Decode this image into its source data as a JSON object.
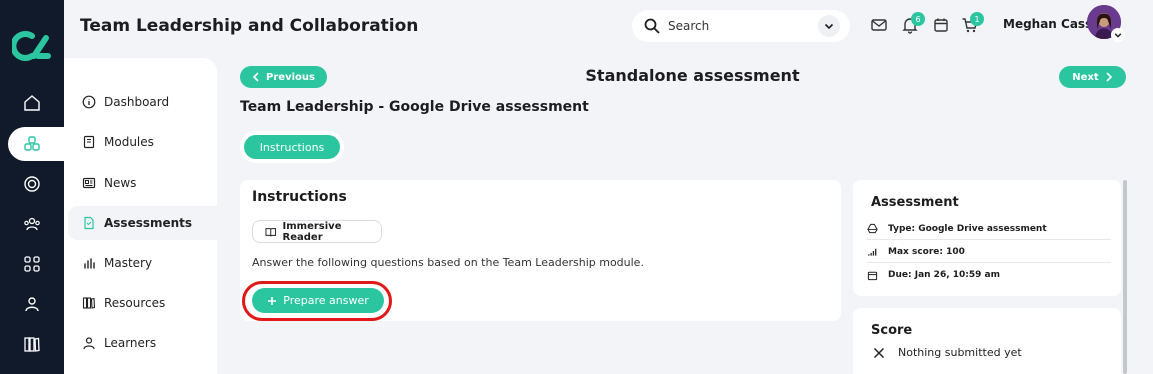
{
  "header": {
    "title": "Team Leadership and Collaboration",
    "search_placeholder": "Search",
    "notifications_count": "6",
    "cart_count": "1",
    "user_name": "Meghan Cass"
  },
  "sidebar": {
    "items": [
      {
        "label": "Dashboard",
        "icon": "info-circle-icon"
      },
      {
        "label": "Modules",
        "icon": "book-icon"
      },
      {
        "label": "News",
        "icon": "newspaper-icon"
      },
      {
        "label": "Assessments",
        "icon": "document-icon"
      },
      {
        "label": "Mastery",
        "icon": "bar-chart-icon"
      },
      {
        "label": "Resources",
        "icon": "library-icon"
      },
      {
        "label": "Learners",
        "icon": "person-icon"
      }
    ]
  },
  "main": {
    "prev_label": "Previous",
    "next_label": "Next",
    "page_title": "Standalone assessment",
    "subtitle": "Team Leadership - Google Drive assessment",
    "tab_label": "Instructions",
    "instructions": {
      "heading": "Instructions",
      "reader_label": "Immersive Reader",
      "text": "Answer the following questions based on the Team Leadership module.",
      "prepare_label": "Prepare answer"
    },
    "assessment": {
      "heading": "Assessment",
      "type": "Type: Google Drive assessment",
      "max_score": "Max score: 100",
      "due": "Due: Jan 26, 10:59 am"
    },
    "score": {
      "heading": "Score",
      "status": "Nothing submitted yet"
    }
  },
  "colors": {
    "accent": "#2bc6a0",
    "rail": "#101a2b",
    "highlight": "#e01818"
  }
}
